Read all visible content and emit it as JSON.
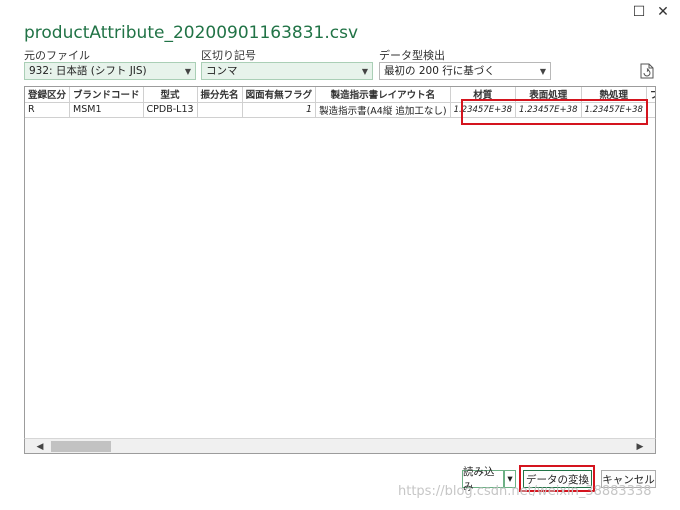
{
  "window": {
    "title": "productAttribute_20200901163831.csv",
    "maximize_icon": "maximize-icon",
    "close_icon": "close-icon"
  },
  "options": {
    "file_origin": {
      "label": "元のファイル",
      "value": "932: 日本語 (シフト JIS)"
    },
    "delimiter": {
      "label": "区切り記号",
      "value": "コンマ"
    },
    "type_detection": {
      "label": "データ型検出",
      "value": "最初の 200 行に基づく"
    }
  },
  "preview": {
    "columns": [
      "登録区分",
      "ブランドコード",
      "型式",
      "振分先名",
      "図面有無フラグ",
      "製造指示書レイアウト名",
      "材質",
      "表面処理",
      "熱処理",
      "ブラ"
    ],
    "rows": [
      [
        "R",
        "MSM1",
        "CPDB-L13",
        "",
        "1",
        "製造指示書(A4縦 追加工なし)",
        "1.23457E+38",
        "1.23457E+38",
        "1.23457E+38",
        ""
      ]
    ]
  },
  "buttons": {
    "load": "読み込み",
    "load_dropdown": "▾",
    "transform": "データの変換",
    "cancel": "キャンセル"
  },
  "watermark": "https://blog.csdn.net/weixin_38883338",
  "colors": {
    "accent": "#217346",
    "highlight": "#d4141e",
    "dropdown_bg": "#e7f3eb"
  }
}
